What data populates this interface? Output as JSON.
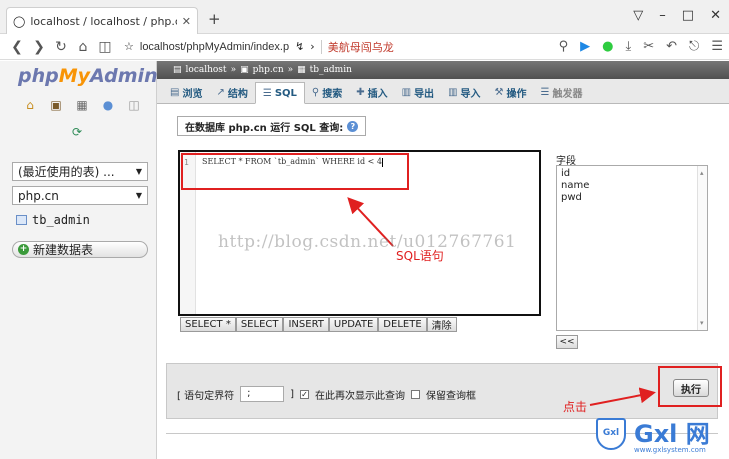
{
  "browser": {
    "tab_title": "localhost / localhost / php.cn / tb",
    "new_tab": "+",
    "url": "localhost/phpMyAdmin/index.p",
    "bookmark": "美航母闯乌龙",
    "win_controls": [
      "–",
      "□",
      "✕"
    ]
  },
  "left": {
    "logo_php": "php",
    "logo_my": "My",
    "logo_admin": "Admin",
    "recent_tables": "(最近使用的表) ...",
    "database": "php.cn",
    "table_item": "tb_admin",
    "new_table": "新建数据表"
  },
  "breadcrumb": {
    "server": "localhost",
    "database": "php.cn",
    "table": "tb_admin",
    "sep": "»"
  },
  "tabs": [
    {
      "label": "浏览",
      "icon": "▤"
    },
    {
      "label": "结构",
      "icon": "↗"
    },
    {
      "label": "SQL",
      "icon": "☰"
    },
    {
      "label": "搜索",
      "icon": "⚲"
    },
    {
      "label": "插入",
      "icon": "✚"
    },
    {
      "label": "导出",
      "icon": "▥"
    },
    {
      "label": "导入",
      "icon": "▥"
    },
    {
      "label": "操作",
      "icon": "⚒"
    },
    {
      "label": "触发器",
      "icon": "☰"
    }
  ],
  "query_box": {
    "legend": "在数据库 php.cn 运行 SQL 查询:",
    "line_number": "1",
    "sql": "SELECT * FROM `tb_admin` WHERE id < 4",
    "buttons": [
      "SELECT *",
      "SELECT",
      "INSERT",
      "UPDATE",
      "DELETE",
      "清除"
    ]
  },
  "fields": {
    "label": "字段",
    "items": [
      "id",
      "name",
      "pwd"
    ],
    "insert_button": "<<"
  },
  "options": {
    "delimiter_label": "[ 语句定界符",
    "delimiter_value": ";",
    "delimiter_close": "]",
    "show_again_label": "在此再次显示此查询",
    "show_again_checked": true,
    "keep_box_label": "保留查询框",
    "keep_box_checked": false,
    "execute": "执行"
  },
  "annotations": {
    "sql_note": "SQL语句",
    "click_note": "点击",
    "watermark": "http://blog.csdn.net/u012767761",
    "logo_text": "Gxl 网",
    "logo_shield": "Gxl",
    "logo_url": "www.gxlsystem.com"
  }
}
